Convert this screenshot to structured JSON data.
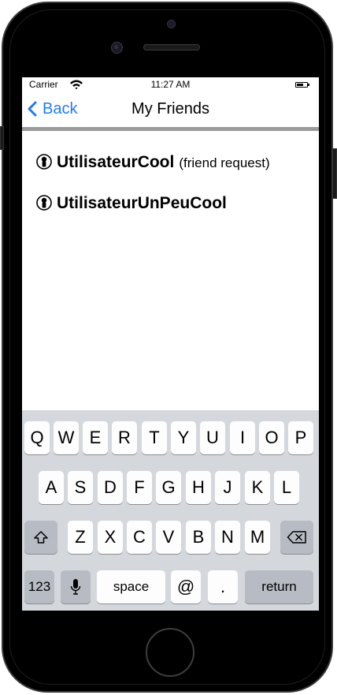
{
  "status_bar": {
    "carrier": "Carrier",
    "time": "11:27 AM"
  },
  "nav": {
    "back_label": "Back",
    "title": "My Friends"
  },
  "friends": [
    {
      "name": "UtilisateurCool",
      "note": "(friend request)"
    },
    {
      "name": "UtilisateurUnPeuCool",
      "note": ""
    }
  ],
  "keyboard": {
    "row1": [
      "Q",
      "W",
      "E",
      "R",
      "T",
      "Y",
      "U",
      "I",
      "O",
      "P"
    ],
    "row2": [
      "A",
      "S",
      "D",
      "F",
      "G",
      "H",
      "J",
      "K",
      "L"
    ],
    "row3": [
      "Z",
      "X",
      "C",
      "V",
      "B",
      "N",
      "M"
    ],
    "numbers_label": "123",
    "space_label": "space",
    "at_label": "@",
    "dot_label": ".",
    "return_label": "return"
  },
  "colors": {
    "accent": "#1e7cf2",
    "keyboard_bg": "#d4d8dd",
    "key_bg": "#fdfdfd",
    "key_dark_bg": "#b7bcc4"
  },
  "icons": [
    "wifi-icon",
    "battery-icon",
    "back-chevron-icon",
    "user-icon",
    "shift-icon",
    "backspace-icon",
    "microphone-icon"
  ]
}
